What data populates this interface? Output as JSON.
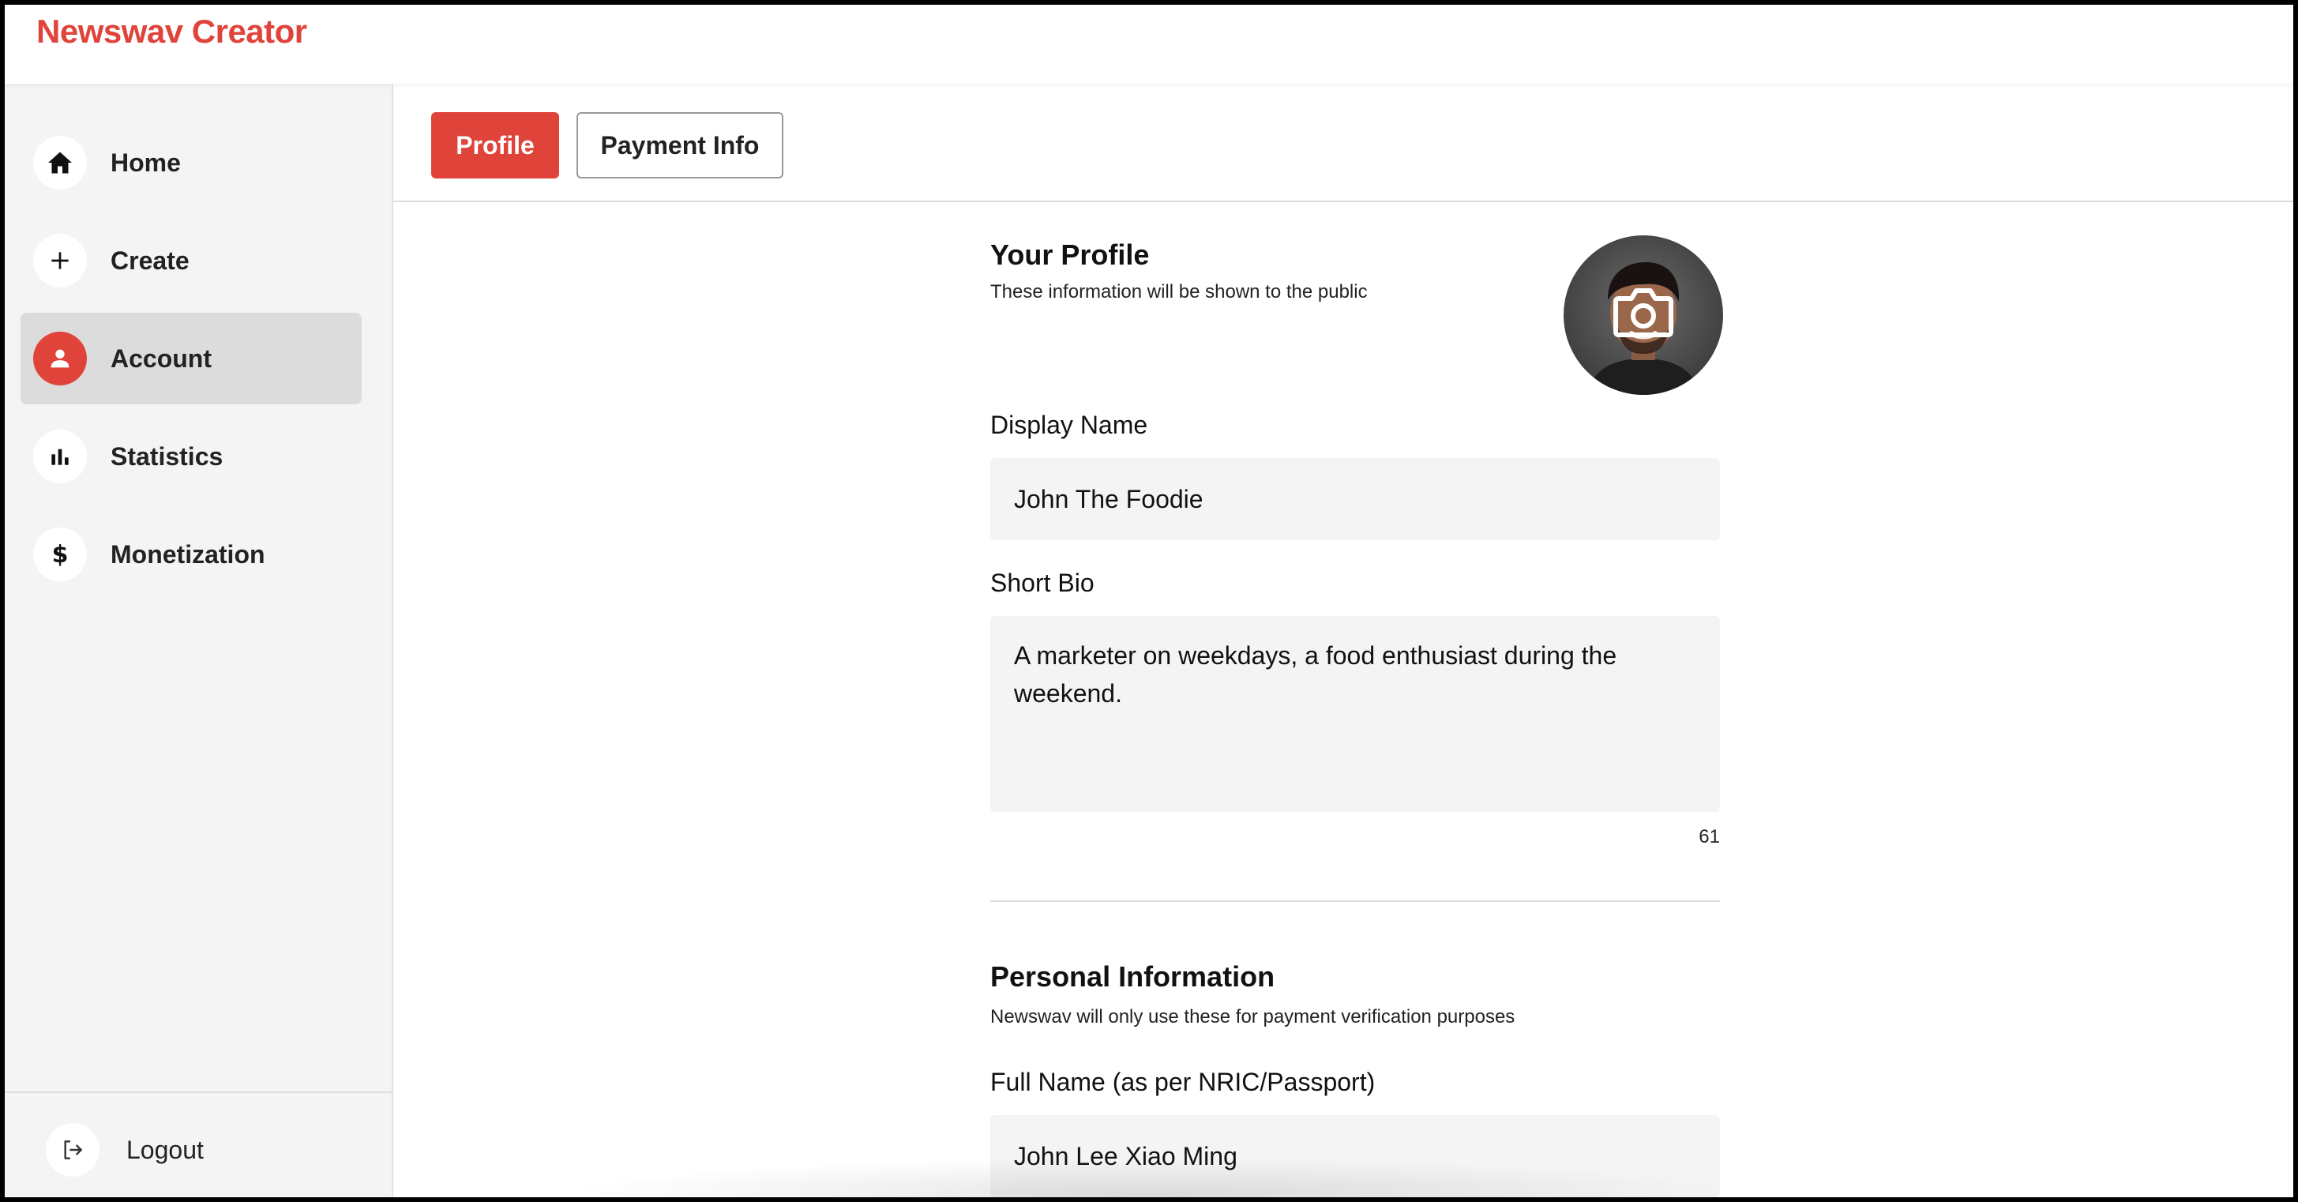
{
  "app": {
    "brand": "Newswav Creator"
  },
  "sidebar": {
    "items": [
      {
        "label": "Home",
        "icon": "home-icon"
      },
      {
        "label": "Create",
        "icon": "plus-icon"
      },
      {
        "label": "Account",
        "icon": "user-icon",
        "active": true
      },
      {
        "label": "Statistics",
        "icon": "bar-chart-icon"
      },
      {
        "label": "Monetization",
        "icon": "dollar-icon"
      }
    ],
    "logout_label": "Logout"
  },
  "tabs": [
    {
      "label": "Profile",
      "active": true
    },
    {
      "label": "Payment Info",
      "active": false
    }
  ],
  "profile": {
    "title": "Your Profile",
    "subtitle": "These information will be shown to the public",
    "display_name_label": "Display Name",
    "display_name_value": "John The Foodie",
    "bio_label": "Short Bio",
    "bio_value": "A marketer on weekdays, a food enthusiast during the weekend.",
    "bio_char_count": "61"
  },
  "personal": {
    "title": "Personal Information",
    "subtitle": "Newswav will only use these for payment verification purposes",
    "full_name_label": "Full Name (as per NRIC/Passport)",
    "full_name_value": "John Lee Xiao Ming"
  },
  "colors": {
    "accent": "#e0433a",
    "sidebar_bg": "#f4f4f4",
    "field_bg": "#f4f4f4"
  }
}
